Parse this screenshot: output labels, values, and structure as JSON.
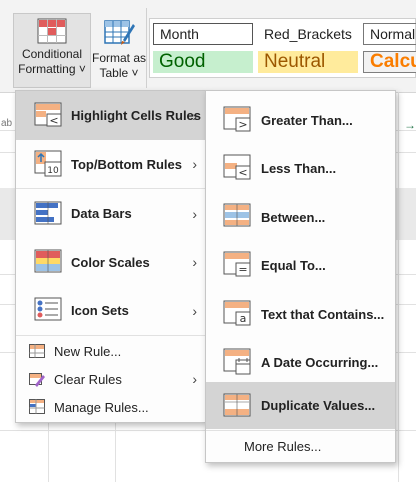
{
  "ribbon": {
    "conditional_formatting": {
      "line1": "Conditional",
      "line2": "Formatting ˅"
    },
    "format_as_table": {
      "line1": "Format as",
      "line2": "Table ˅"
    },
    "styles": {
      "month": "Month",
      "red_brackets": "Red_Brackets",
      "normal": "Normal",
      "good": "Good",
      "neutral": "Neutral",
      "calculation": "Calcu"
    }
  },
  "sheet": {
    "formula_fragment": "ab",
    "arrow": "→"
  },
  "main_menu": {
    "items": [
      {
        "label": "Highlight Cells Rules",
        "highlighted": true
      },
      {
        "label": "Top/Bottom Rules"
      },
      {
        "label": "Data Bars"
      },
      {
        "label": "Color Scales"
      },
      {
        "label": "Icon Sets"
      }
    ],
    "lower_items": [
      {
        "label": "New Rule..."
      },
      {
        "label": "Clear Rules"
      },
      {
        "label": "Manage Rules..."
      }
    ],
    "topbottom_badge": "10"
  },
  "sub_menu": {
    "items": [
      {
        "label": "Greater Than..."
      },
      {
        "label": "Less Than..."
      },
      {
        "label": "Between..."
      },
      {
        "label": "Equal To..."
      },
      {
        "label": "Text that Contains..."
      },
      {
        "label": "A Date Occurring..."
      },
      {
        "label": "Duplicate Values...",
        "highlighted": true
      }
    ],
    "more_rules": "More Rules..."
  },
  "colors": {
    "accent_orange": "#f4b183",
    "accent_blue": "#4472c4",
    "good_bg": "#c6efce",
    "neutral_bg": "#ffeb9c",
    "highlight": "#d4d4d4"
  }
}
